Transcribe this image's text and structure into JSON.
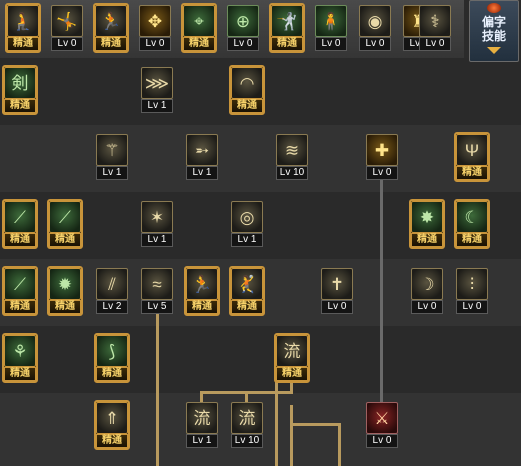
{
  "side_button": {
    "label_line1": "偏字",
    "label_line2": "技能"
  },
  "level_prefix": "Lv",
  "mastered_label": "精通",
  "top_row": [
    {
      "icon": "kneeling-fighter-icon",
      "glyph": "🧎",
      "state": "mastered",
      "level": null
    },
    {
      "icon": "leaping-fighter-icon",
      "glyph": "🤸",
      "state": "level",
      "level": 0
    },
    {
      "icon": "running-fighter-icon",
      "glyph": "🏃",
      "state": "mastered",
      "level": null
    },
    {
      "icon": "winged-emblem-icon",
      "glyph": "✥",
      "state": "level",
      "level": 0
    },
    {
      "icon": "crosshair-icon",
      "glyph": "⌖",
      "state": "mastered",
      "level": null
    },
    {
      "icon": "crosshair-target-icon",
      "glyph": "⊕",
      "state": "level",
      "level": 0
    },
    {
      "icon": "striking-fighter-icon",
      "glyph": "🤺",
      "state": "mastered",
      "level": null
    },
    {
      "icon": "crouching-fighter-icon",
      "glyph": "🧍",
      "state": "level",
      "level": 0
    },
    {
      "icon": "spiral-eye-icon",
      "glyph": "◉",
      "state": "level",
      "level": 0
    },
    {
      "icon": "golden-warrior-icon",
      "glyph": "♜",
      "state": "level",
      "level": 0
    },
    {
      "icon": "dragon-figure-icon",
      "glyph": "⚕",
      "state": "level",
      "level": 0
    }
  ],
  "tree": [
    {
      "icon": "sword-character-icon",
      "glyph": "剣",
      "state": "mastered",
      "level": null
    },
    {
      "icon": "claw-slash-icon",
      "glyph": "⋙",
      "state": "level",
      "level": 1
    },
    {
      "icon": "sweep-slash-icon",
      "glyph": "◠",
      "state": "mastered",
      "level": null
    },
    {
      "icon": "triple-spike-icon",
      "glyph": "⚚",
      "state": "level",
      "level": 1
    },
    {
      "icon": "arrow-dash-icon",
      "glyph": "➵",
      "state": "level",
      "level": 1
    },
    {
      "icon": "wind-arc-icon",
      "glyph": "≋",
      "state": "level",
      "level": 10
    },
    {
      "icon": "shield-cross-icon",
      "glyph": "✚",
      "state": "level",
      "level": 0
    },
    {
      "icon": "trident-flame-icon",
      "glyph": "Ψ",
      "state": "mastered",
      "level": null
    },
    {
      "icon": "green-blade-icon",
      "glyph": "⟋",
      "state": "mastered",
      "level": null
    },
    {
      "icon": "green-slash-icon",
      "glyph": "⟋",
      "state": "mastered",
      "level": null
    },
    {
      "icon": "burst-claw-icon",
      "glyph": "✶",
      "state": "level",
      "level": 1
    },
    {
      "icon": "vortex-slash-icon",
      "glyph": "◎",
      "state": "level",
      "level": 1
    },
    {
      "icon": "star-burst-icon",
      "glyph": "✸",
      "state": "mastered",
      "level": null
    },
    {
      "icon": "green-crescent-icon",
      "glyph": "☾",
      "state": "mastered",
      "level": null
    },
    {
      "icon": "long-blade-icon",
      "glyph": "⟋",
      "state": "mastered",
      "level": null
    },
    {
      "icon": "spiky-burst-icon",
      "glyph": "✹",
      "state": "mastered",
      "level": null
    },
    {
      "icon": "dual-blade-icon",
      "glyph": "⫽",
      "state": "level",
      "level": 2
    },
    {
      "icon": "swirl-wind-icon",
      "glyph": "≈",
      "state": "level",
      "level": 5
    },
    {
      "icon": "dash-fighter-icon",
      "glyph": "🏃",
      "state": "mastered",
      "level": null
    },
    {
      "icon": "kick-fighter-icon",
      "glyph": "🤾",
      "state": "mastered",
      "level": null
    },
    {
      "icon": "cross-sword-icon",
      "glyph": "✝",
      "state": "level",
      "level": 0
    },
    {
      "icon": "moon-arc-icon",
      "glyph": "☽",
      "state": "level",
      "level": 0
    },
    {
      "icon": "claw-marks-icon",
      "glyph": "⫶",
      "state": "level",
      "level": 0
    },
    {
      "icon": "feather-branch-icon",
      "glyph": "⚘",
      "state": "mastered",
      "level": null
    },
    {
      "icon": "triple-arc-icon",
      "glyph": "⟆",
      "state": "mastered",
      "level": null
    },
    {
      "icon": "flow-character-icon",
      "glyph": "流",
      "state": "mastered",
      "level": null
    },
    {
      "icon": "rising-arrow-icon",
      "glyph": "⇑",
      "state": "mastered",
      "level": null
    },
    {
      "icon": "flow-wing-icon",
      "glyph": "流",
      "state": "level",
      "level": 1
    },
    {
      "icon": "flow-moon-icon",
      "glyph": "流",
      "state": "level",
      "level": 10
    },
    {
      "icon": "locked-sword-icon",
      "glyph": "⚔",
      "state": "level",
      "level": 0
    }
  ]
}
